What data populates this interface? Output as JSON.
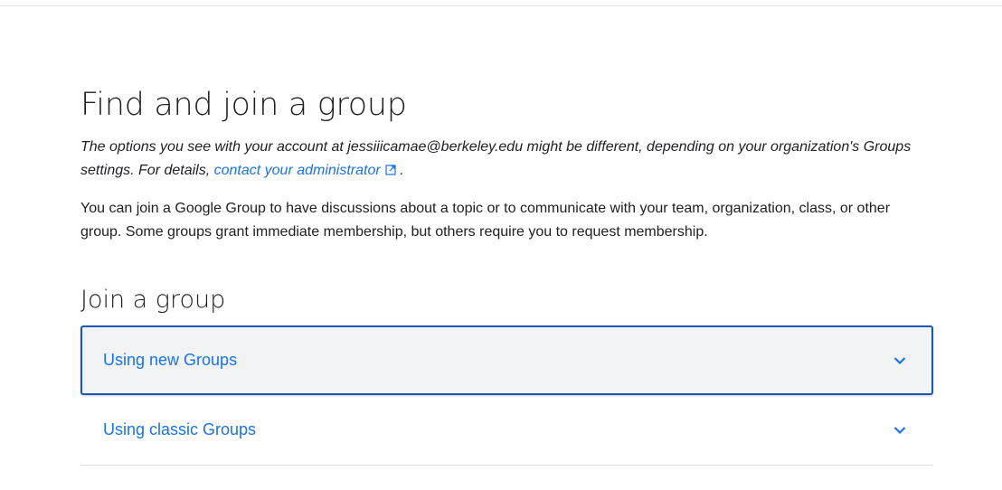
{
  "page": {
    "title": "Find and join a group",
    "note_prefix": "The options you see with your account at jessiiicamae@berkeley.edu might be different, depending on your organization's Groups settings. For details,",
    "note_link": "contact your administrator",
    "note_suffix": ".",
    "intro": "You can join a Google Group to have discussions about a topic or to communicate with your team, organization, class, or other group. Some groups grant immediate membership, but others require you to request membership."
  },
  "section": {
    "title": "Join a group",
    "items": [
      {
        "label": "Using new Groups",
        "icon": "chevron-down-icon",
        "state": "focused"
      },
      {
        "label": "Using classic Groups",
        "icon": "chevron-down-icon",
        "state": "collapsed"
      }
    ]
  },
  "colors": {
    "link": "#1a73e8",
    "focus_border": "#1a56b8",
    "focused_bg": "#f1f3f4"
  }
}
